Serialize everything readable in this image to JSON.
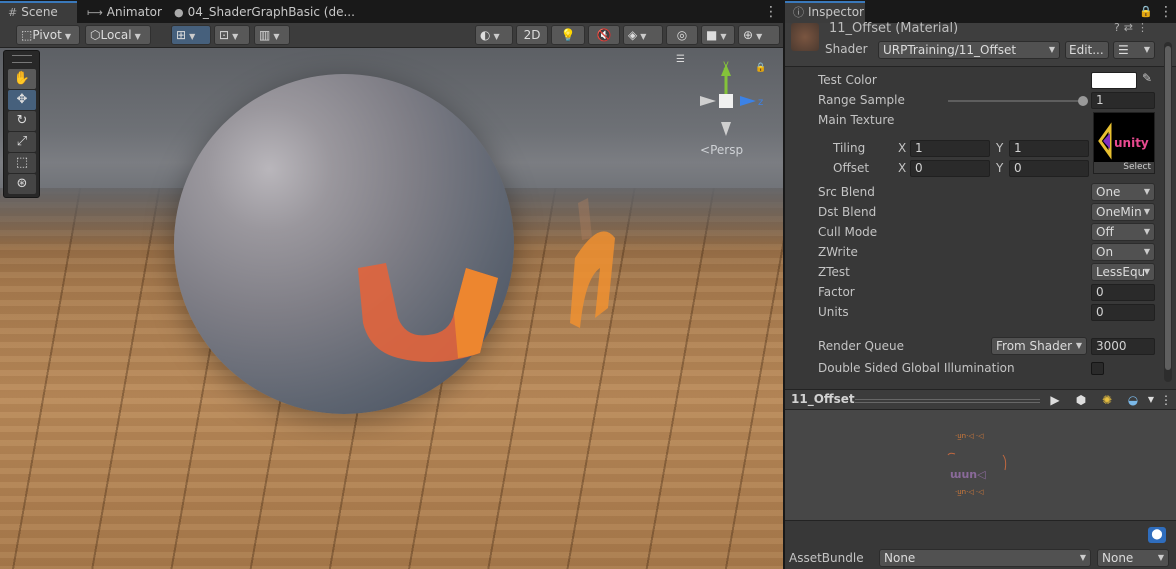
{
  "scene_tabs": {
    "scene": "Scene",
    "animator": "Animator",
    "shadergraph": "04_ShaderGraphBasic (de..."
  },
  "scene_toolbar": {
    "pivot": "Pivot",
    "local": "Local",
    "mode_2d": "2D"
  },
  "viewport": {
    "persp_label": "Persp",
    "axis_y": "y",
    "axis_z": "z"
  },
  "inspector": {
    "tab": "Inspector",
    "material_title": "11_Offset (Material)",
    "shader_label": "Shader",
    "shader_value": "URPTraining/11_Offset",
    "edit_button": "Edit...",
    "properties": {
      "test_color": "Test Color",
      "range_sample": "Range Sample",
      "range_sample_value": "1",
      "range_sample_level": 1.0,
      "main_texture": "Main Texture",
      "tiling": "Tiling",
      "tiling_x": "1",
      "tiling_y": "1",
      "offset": "Offset",
      "offset_x": "0",
      "offset_y": "0",
      "x_label": "X",
      "y_label": "Y",
      "texture_select": "Select",
      "src_blend": "Src Blend",
      "src_blend_value": "One",
      "dst_blend": "Dst Blend",
      "dst_blend_value": "OneMin",
      "cull_mode": "Cull Mode",
      "cull_mode_value": "Off",
      "zwrite": "ZWrite",
      "zwrite_value": "On",
      "ztest": "ZTest",
      "ztest_value": "LessEqu",
      "factor": "Factor",
      "factor_value": "0",
      "units": "Units",
      "units_value": "0",
      "render_queue": "Render Queue",
      "render_queue_mode": "From Shader",
      "render_queue_value": "3000",
      "double_sided_gi": "Double Sided Global Illumination"
    },
    "preview_title": "11_Offset",
    "assetbundle_label": "AssetBundle",
    "assetbundle_value": "None",
    "assetbundle_variant": "None"
  },
  "colors": {
    "accent": "#3a79bb",
    "test_color": "#ffffff"
  }
}
